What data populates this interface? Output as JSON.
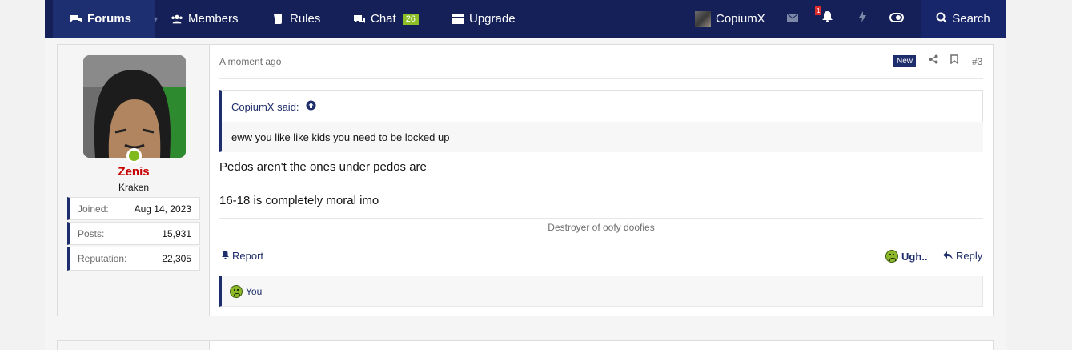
{
  "nav": {
    "forums": "Forums",
    "members": "Members",
    "rules": "Rules",
    "chat": "Chat",
    "chat_count": "26",
    "upgrade": "Upgrade",
    "username": "CopiumX",
    "alert_count": "1",
    "search": "Search"
  },
  "post": {
    "user": {
      "name": "Zenis",
      "title": "Kraken",
      "stats": [
        {
          "label": "Joined:",
          "value": "Aug 14, 2023"
        },
        {
          "label": "Posts:",
          "value": "15,931"
        },
        {
          "label": "Reputation:",
          "value": "22,305"
        }
      ]
    },
    "time": "A moment ago",
    "new_label": "New",
    "number": "#3",
    "quote": {
      "author": "CopiumX said:",
      "text": "eww you like like kids you need to be locked up"
    },
    "lines": [
      "Pedos aren't the ones under pedos are",
      "16-18 is completely moral imo"
    ],
    "signature": "Destroyer of oofy doofies",
    "actions": {
      "report": "Report",
      "reaction": "Ugh..",
      "reply": "Reply"
    },
    "reactions_by": "You"
  },
  "colors": {
    "nav_bg": "#142057",
    "accent": "#1e2d6b",
    "username": "#c70000",
    "online": "#7fb91c",
    "chat_badge": "#8cbf26"
  }
}
